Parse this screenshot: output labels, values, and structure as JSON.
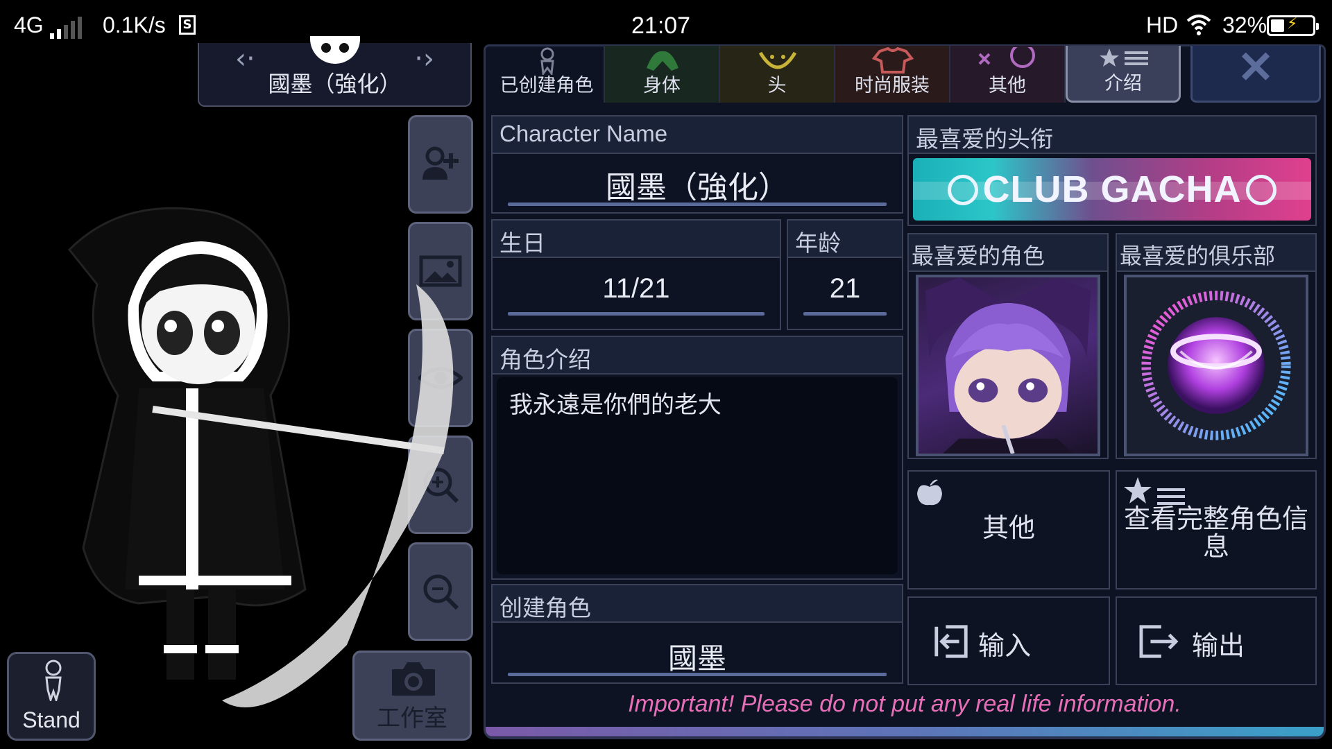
{
  "status_bar": {
    "network": "4G",
    "speed": "0.1K/s",
    "time": "21:07",
    "hd": "HD",
    "battery": "32%"
  },
  "character": {
    "name": "國墨（強化）"
  },
  "left_buttons": {
    "stand": "Stand",
    "studio": "工作室"
  },
  "tabs": [
    {
      "label": "已创建角色",
      "icon": "person-icon"
    },
    {
      "label": "身体",
      "icon": "body-icon"
    },
    {
      "label": "头",
      "icon": "head-icon"
    },
    {
      "label": "时尚服装",
      "icon": "shirt-icon"
    },
    {
      "label": "其他",
      "icon": "misc-icon"
    },
    {
      "label": "介绍",
      "icon": "star-list-icon"
    }
  ],
  "profile": {
    "name_label": "Character Name",
    "name_value": "國墨（強化）",
    "birthday_label": "生日",
    "birthday_value": "11/21",
    "age_label": "年龄",
    "age_value": "21",
    "intro_label": "角色介绍",
    "intro_value": "我永遠是你們的老大",
    "creator_label": "创建角色",
    "creator_value": "國墨",
    "title_label": "最喜爱的头衔",
    "title_value": "CLUB GACHA",
    "fav_char_label": "最喜爱的角色",
    "fav_club_label": "最喜爱的俱乐部"
  },
  "actions": {
    "other": "其他",
    "view_full": "查看完整角色信息",
    "import": "输入",
    "export": "输出"
  },
  "warning": "Important! Please do not put any real life information.",
  "colors": {
    "panel_bg": "#0d1322",
    "accent_pink": "#e66fb8"
  }
}
